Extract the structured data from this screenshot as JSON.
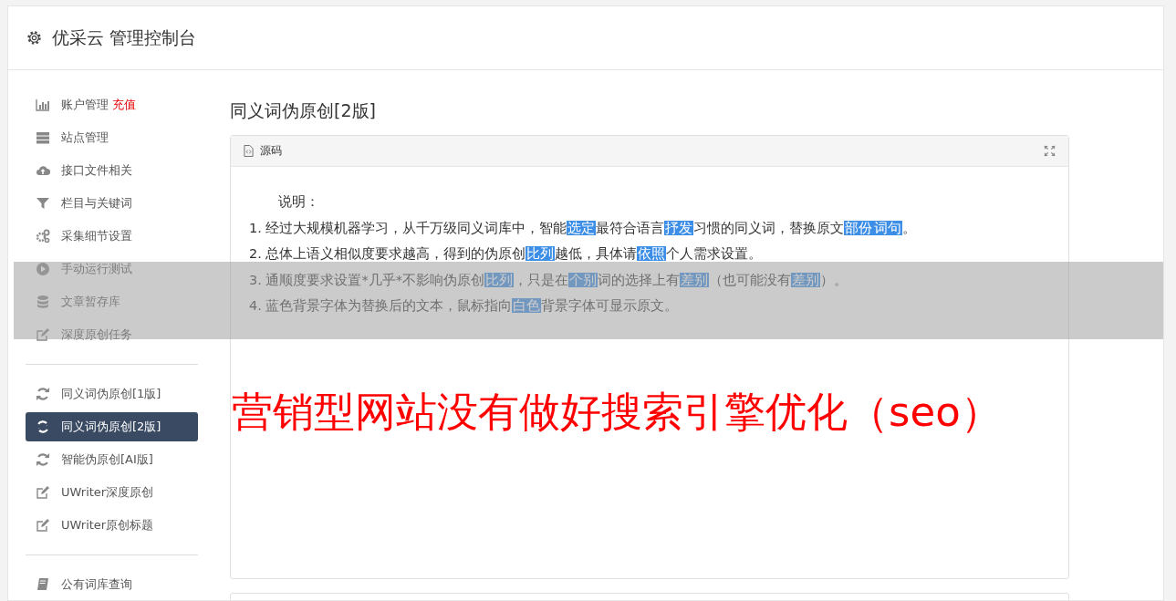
{
  "header": {
    "title": "优采云 管理控制台"
  },
  "sidebar": {
    "groups": [
      {
        "items": [
          {
            "kind": "chart",
            "label": "账户管理",
            "badge": "充值",
            "selected": false
          },
          {
            "kind": "server",
            "label": "站点管理",
            "selected": false
          },
          {
            "kind": "cloud",
            "label": "接口文件相关",
            "selected": false
          },
          {
            "kind": "filter",
            "label": "栏目与关键词",
            "selected": false
          },
          {
            "kind": "gears",
            "label": "采集细节设置",
            "selected": false
          },
          {
            "kind": "play",
            "label": "手动运行测试",
            "selected": false
          },
          {
            "kind": "database",
            "label": "文章暂存库",
            "selected": false
          },
          {
            "kind": "edit",
            "label": "深度原创任务",
            "selected": false
          }
        ]
      },
      {
        "items": [
          {
            "kind": "refresh",
            "label": "同义词伪原创[1版]",
            "selected": false
          },
          {
            "kind": "refresh",
            "label": "同义词伪原创[2版]",
            "selected": true
          },
          {
            "kind": "refresh",
            "label": "智能伪原创[AI版]",
            "selected": false
          },
          {
            "kind": "edit",
            "label": "UWriter深度原创",
            "selected": false
          },
          {
            "kind": "edit",
            "label": "UWriter原创标题",
            "selected": false
          }
        ]
      },
      {
        "items": [
          {
            "kind": "book",
            "label": "公有词库查询",
            "selected": false
          }
        ]
      }
    ]
  },
  "main": {
    "title": "同义词伪原创[2版]",
    "panel": {
      "tab": "源码",
      "intro": "说明：",
      "lines": [
        [
          {
            "text": "1. 经过大规模机器学习，从千万级同义词库中，智能",
            "replaced": false
          },
          {
            "text": "选定",
            "replaced": true
          },
          {
            "text": "最符合语言",
            "replaced": false
          },
          {
            "text": "抒发",
            "replaced": true
          },
          {
            "text": "习惯的同义词，替换原文",
            "replaced": false
          },
          {
            "text": "部份",
            "replaced": true
          },
          {
            "text": "词句",
            "replaced": true
          },
          {
            "text": "。",
            "replaced": false
          }
        ],
        [
          {
            "text": "2. 总体上语义相似度要求越高，得到的伪原创",
            "replaced": false
          },
          {
            "text": "比列",
            "replaced": true
          },
          {
            "text": "越低，具体请",
            "replaced": false
          },
          {
            "text": "依照",
            "replaced": true
          },
          {
            "text": "个人需求设置。",
            "replaced": false
          }
        ],
        [
          {
            "text": "3. 通顺度要求设置*几乎*不影响伪原创",
            "replaced": false
          },
          {
            "text": "比列",
            "replaced": true
          },
          {
            "text": "，只是在",
            "replaced": false
          },
          {
            "text": "个别",
            "replaced": true
          },
          {
            "text": "词的选择上有",
            "replaced": false
          },
          {
            "text": "差别",
            "replaced": true
          },
          {
            "text": "（也可能没有",
            "replaced": false
          },
          {
            "text": "差别",
            "replaced": true
          },
          {
            "text": "）。",
            "replaced": false
          }
        ],
        [
          {
            "text": "4. 蓝色背景字体为替换后的文本，鼠标指向",
            "replaced": false
          },
          {
            "text": "白色",
            "replaced": true
          },
          {
            "text": "背景字体可显示原文。",
            "replaced": false
          }
        ]
      ]
    }
  },
  "overlay": {
    "caption": "营销型网站没有做好搜索引擎优化（seo）"
  }
}
